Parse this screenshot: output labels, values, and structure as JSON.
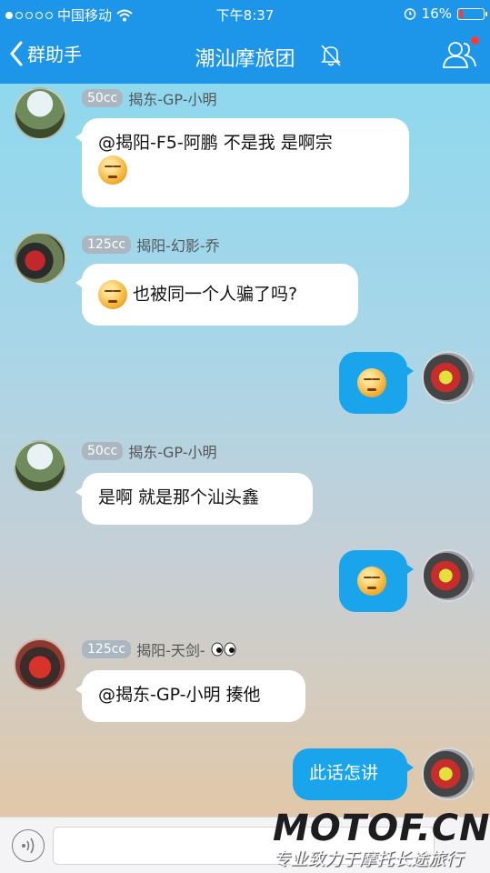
{
  "status": {
    "carrier": "中国移动",
    "time": "下午8:37",
    "battery": "16%",
    "battery_level": 0.16,
    "colors": {
      "battery_low": "#ff3b30"
    }
  },
  "nav": {
    "back_label": "群助手",
    "title": "潮汕摩旅团",
    "icons": [
      "bell-muted-icon",
      "group-members-icon"
    ]
  },
  "messages": [
    {
      "side": "left",
      "badge": "50cc",
      "sender": "揭东-GP-小明",
      "text": "@揭阳-F5-阿鹏 不是我  是啊宗"
    },
    {
      "side": "left",
      "badge": "125cc",
      "sender": "揭阳-幻影-乔",
      "text": "也被同一个人骗了吗?"
    },
    {
      "side": "right",
      "emoji": "sweat-emoji"
    },
    {
      "side": "left",
      "badge": "50cc",
      "sender": "揭东-GP-小明",
      "text": "是啊  就是那个汕头鑫"
    },
    {
      "side": "right",
      "emoji": "blush-emoji"
    },
    {
      "side": "left",
      "badge": "125cc",
      "sender": "揭阳-天剑-",
      "text": "@揭东-GP-小明 揍他"
    },
    {
      "side": "right",
      "text": "此话怎讲"
    }
  ],
  "input": {
    "placeholder": ""
  },
  "watermark": {
    "logo": "MOTOF.CN",
    "slogan": "专业致力于摩托长途旅行"
  }
}
